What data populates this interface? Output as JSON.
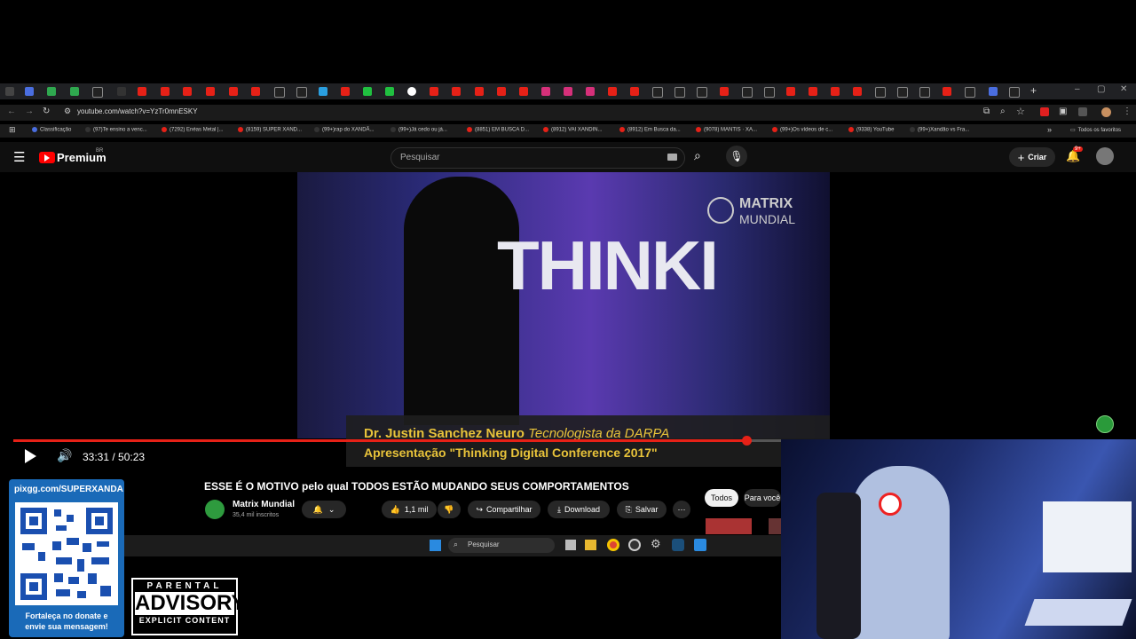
{
  "browser": {
    "url": "youtube.com/watch?v=YzTr0mnESKY",
    "bookmarks": [
      "Classificação",
      "(97)Te ensino a venc...",
      "(7292) Enéas Metal |...",
      "(8159) SUPER XAND...",
      "(99+)rap do XANDÃ...",
      "(99+)Já cedo ou já...",
      "(8851) EM BUSCA D...",
      "(8912) VAI XANDIN...",
      "(8912) Em Busca da...",
      "(9078) MANTIS · XA...",
      "(99+)Os vídeos de c...",
      "(9338) YouTube",
      "(99+)Xandão vs Fra..."
    ],
    "all_favorites": "Todos os favoritos"
  },
  "youtube": {
    "logo": "Premium",
    "logo_sup": "BR",
    "search_placeholder": "Pesquisar",
    "create_label": "Criar",
    "notif_badge": "9+"
  },
  "video": {
    "watermark_line1": "MATRIX",
    "watermark_line2": "MUNDIAL",
    "stage_text": "THINKI",
    "caption_name": "Dr. Justin Sanchez Neuro",
    "caption_role": "Tecnologista da DARPA",
    "caption_line2": "Apresentação \"Thinking Digital Conference 2017\"",
    "time_current": "33:31",
    "time_total": "50:23",
    "progress": 0.955
  },
  "details": {
    "title": "ESSE É O MOTIVO pelo qual TODOS ESTÃO MUDANDO SEUS COMPORTAMENTOS",
    "channel_name": "Matrix Mundial",
    "subscribers": "35,4 mil inscritos",
    "likes": "1,1 mil",
    "share": "Compartilhar",
    "download": "Download",
    "save": "Salvar",
    "chip_all": "Todos",
    "chip_for_you": "Para você"
  },
  "taskbar": {
    "search_placeholder": "Pesquisar"
  },
  "overlay": {
    "donate_url": "pixgg.com/SUPERXANDA",
    "donate_line1": "Fortaleça no donate e",
    "donate_line2": "envie sua mensagem!",
    "advisory_top": "PARENTAL",
    "advisory_mid": "ADVISORY",
    "advisory_bottom": "EXPLICIT CONTENT"
  }
}
